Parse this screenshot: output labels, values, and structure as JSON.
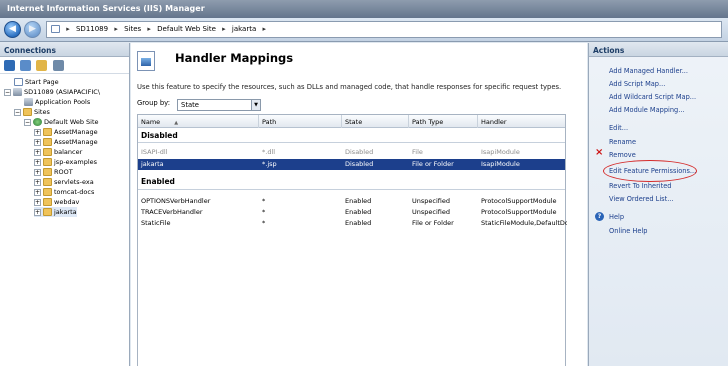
{
  "window": {
    "title": "Internet Information Services (IIS) Manager"
  },
  "address": {
    "crumbs": [
      "SD11089",
      "Sites",
      "Default Web Site",
      "jakarta"
    ],
    "separator": "▸"
  },
  "connections": {
    "title": "Connections",
    "tree": [
      {
        "label": "Start Page"
      },
      {
        "label": "SD11089 (ASIAPACIFIC\\"
      },
      {
        "label": "Application Pools"
      },
      {
        "label": "Sites"
      },
      {
        "label": "Default Web Site"
      },
      {
        "label": "AssetManage"
      },
      {
        "label": "AssetManage"
      },
      {
        "label": "balancer"
      },
      {
        "label": "jsp-examples"
      },
      {
        "label": "ROOT"
      },
      {
        "label": "servlets-exa"
      },
      {
        "label": "tomcat-docs"
      },
      {
        "label": "webdav"
      },
      {
        "label": "jakarta"
      }
    ]
  },
  "feature": {
    "title": "Handler Mappings",
    "description": "Use this feature to specify the resources, such as DLLs and managed code, that handle responses for specific request types.",
    "group_by_label": "Group by:",
    "group_by_value": "State"
  },
  "grid": {
    "columns": [
      "Name",
      "Path",
      "State",
      "Path Type",
      "Handler"
    ],
    "sort_indicator": "▲",
    "groups": [
      {
        "name": "Disabled",
        "rows": [
          {
            "name": "ISAPI-dll",
            "path": "*.dll",
            "state": "Disabled",
            "path_type": "File",
            "handler": "IsapiModule",
            "style": "disabled"
          },
          {
            "name": "jakarta",
            "path": "*.jsp",
            "state": "Disabled",
            "path_type": "File or Folder",
            "handler": "IsapiModule",
            "style": "selected"
          }
        ]
      },
      {
        "name": "Enabled",
        "rows": [
          {
            "name": "OPTIONSVerbHandler",
            "path": "*",
            "state": "Enabled",
            "path_type": "Unspecified",
            "handler": "ProtocolSupportModule",
            "style": ""
          },
          {
            "name": "TRACEVerbHandler",
            "path": "*",
            "state": "Enabled",
            "path_type": "Unspecified",
            "handler": "ProtocolSupportModule",
            "style": ""
          },
          {
            "name": "StaticFile",
            "path": "*",
            "state": "Enabled",
            "path_type": "File or Folder",
            "handler": "StaticFileModule,DefaultDoc",
            "style": ""
          }
        ]
      }
    ]
  },
  "actions": {
    "title": "Actions",
    "items": [
      "Add Managed Handler...",
      "Add Script Map...",
      "Add Wildcard Script Map...",
      "Add Module Mapping...",
      "Edit...",
      "Rename",
      "Remove",
      "Edit Feature Permissions...",
      "Revert To Inherited",
      "View Ordered List...",
      "Help",
      "Online Help"
    ],
    "remove_icon": "×",
    "help_icon": "?"
  },
  "colors": {
    "selection": "#1c3f8c",
    "link": "#1c3f8c",
    "remove": "#cc1111",
    "annotation_circle": "#d42a2a"
  }
}
